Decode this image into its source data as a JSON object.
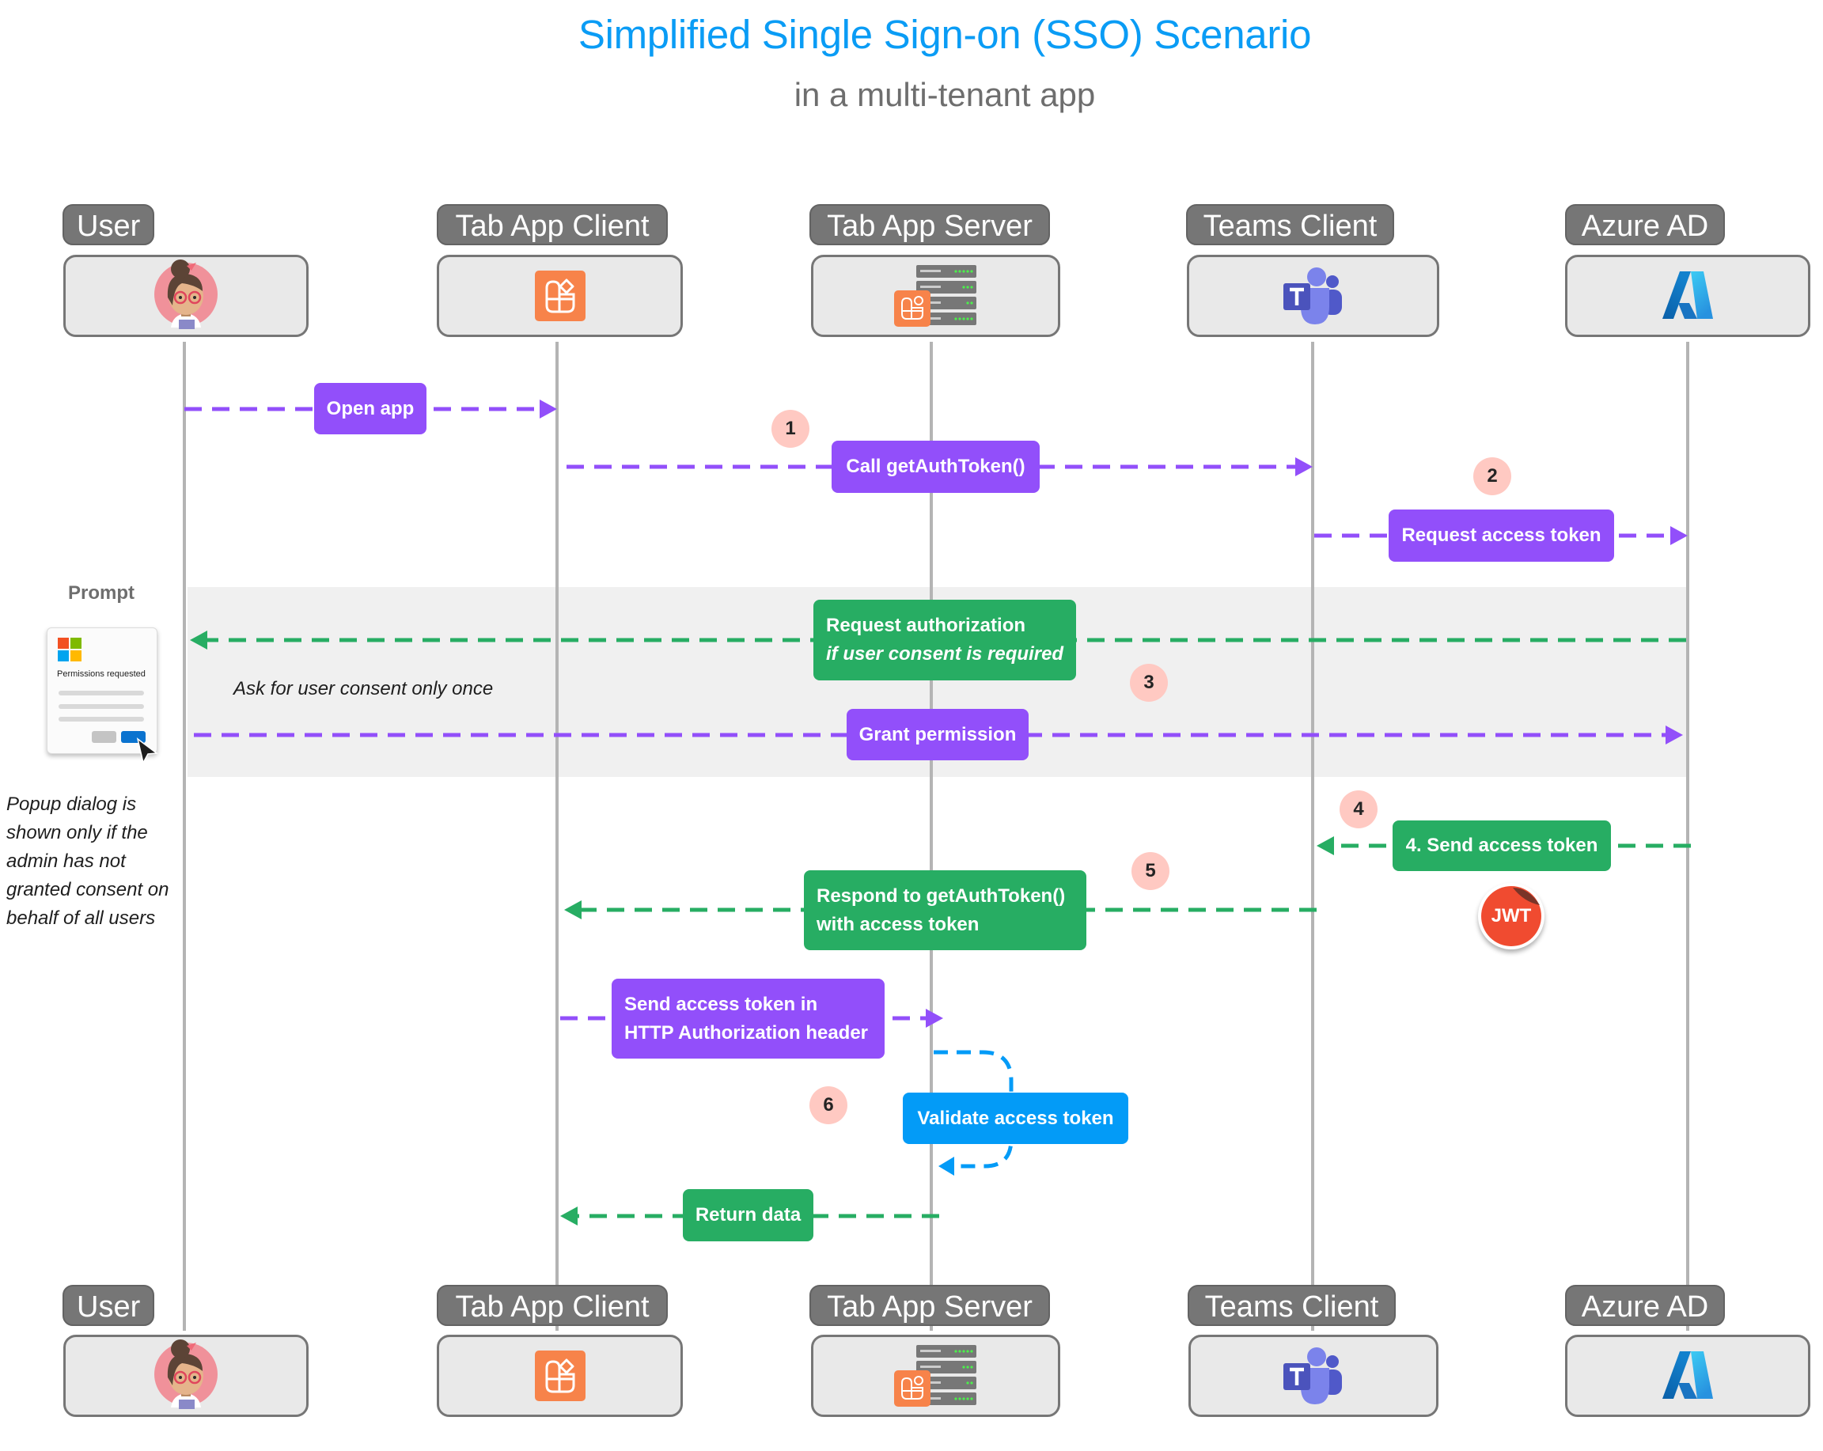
{
  "title": "Simplified Single Sign-on (SSO) Scenario",
  "subtitle": "in a multi-tenant app",
  "actors": [
    {
      "id": "user",
      "label": "User",
      "icon": "user-avatar-icon"
    },
    {
      "id": "client",
      "label": "Tab App Client",
      "icon": "app-grid-icon"
    },
    {
      "id": "server",
      "label": "Tab App Server",
      "icon": "server-icon"
    },
    {
      "id": "teams",
      "label": "Teams Client",
      "icon": "teams-icon"
    },
    {
      "id": "azure",
      "label": "Azure AD",
      "icon": "azure-icon"
    }
  ],
  "colors": {
    "request": "#924ffa",
    "response": "#27ad63",
    "internal": "#039bf7",
    "badge": "#ffc9c2",
    "title": "#0a9cf5",
    "actor_label": "#767676"
  },
  "messages": [
    {
      "id": "open-app",
      "label": "Open app",
      "from": "user",
      "to": "client",
      "kind": "request"
    },
    {
      "id": "call-get-auth-token",
      "label": "Call getAuthToken()",
      "from": "client",
      "to": "teams",
      "kind": "request"
    },
    {
      "id": "request-access-token",
      "label": "Request access token",
      "from": "teams",
      "to": "azure",
      "kind": "request"
    },
    {
      "id": "request-authorization",
      "label": "Request authorization",
      "sublabel": "if user consent is required",
      "from": "azure",
      "to": "user",
      "kind": "response"
    },
    {
      "id": "grant-permission",
      "label": "Grant permission",
      "from": "user",
      "to": "azure",
      "kind": "request"
    },
    {
      "id": "send-access-token",
      "label": "4. Send access token",
      "from": "azure",
      "to": "teams",
      "kind": "response"
    },
    {
      "id": "respond-get-auth-token",
      "label": "Respond to getAuthToken()",
      "sublabel": "with access token",
      "from": "teams",
      "to": "client",
      "kind": "response"
    },
    {
      "id": "send-token-http",
      "label": "Send access token in",
      "sublabel": "HTTP Authorization header",
      "from": "client",
      "to": "server",
      "kind": "request"
    },
    {
      "id": "validate-access-token",
      "label": "Validate access token",
      "from": "server",
      "to": "server",
      "kind": "internal"
    },
    {
      "id": "return-data",
      "label": "Return data",
      "from": "server",
      "to": "client",
      "kind": "response"
    }
  ],
  "steps": [
    "1",
    "2",
    "3",
    "4",
    "5",
    "6"
  ],
  "consent_band": {
    "note": "Ask for user consent only once"
  },
  "prompt": {
    "heading": "Prompt",
    "dialog_title": "Permissions requested",
    "note_lines": [
      "Popup dialog is",
      "shown only if the",
      "admin has not",
      "granted consent on",
      "behalf of all users"
    ]
  },
  "jwt_badge": "JWT"
}
